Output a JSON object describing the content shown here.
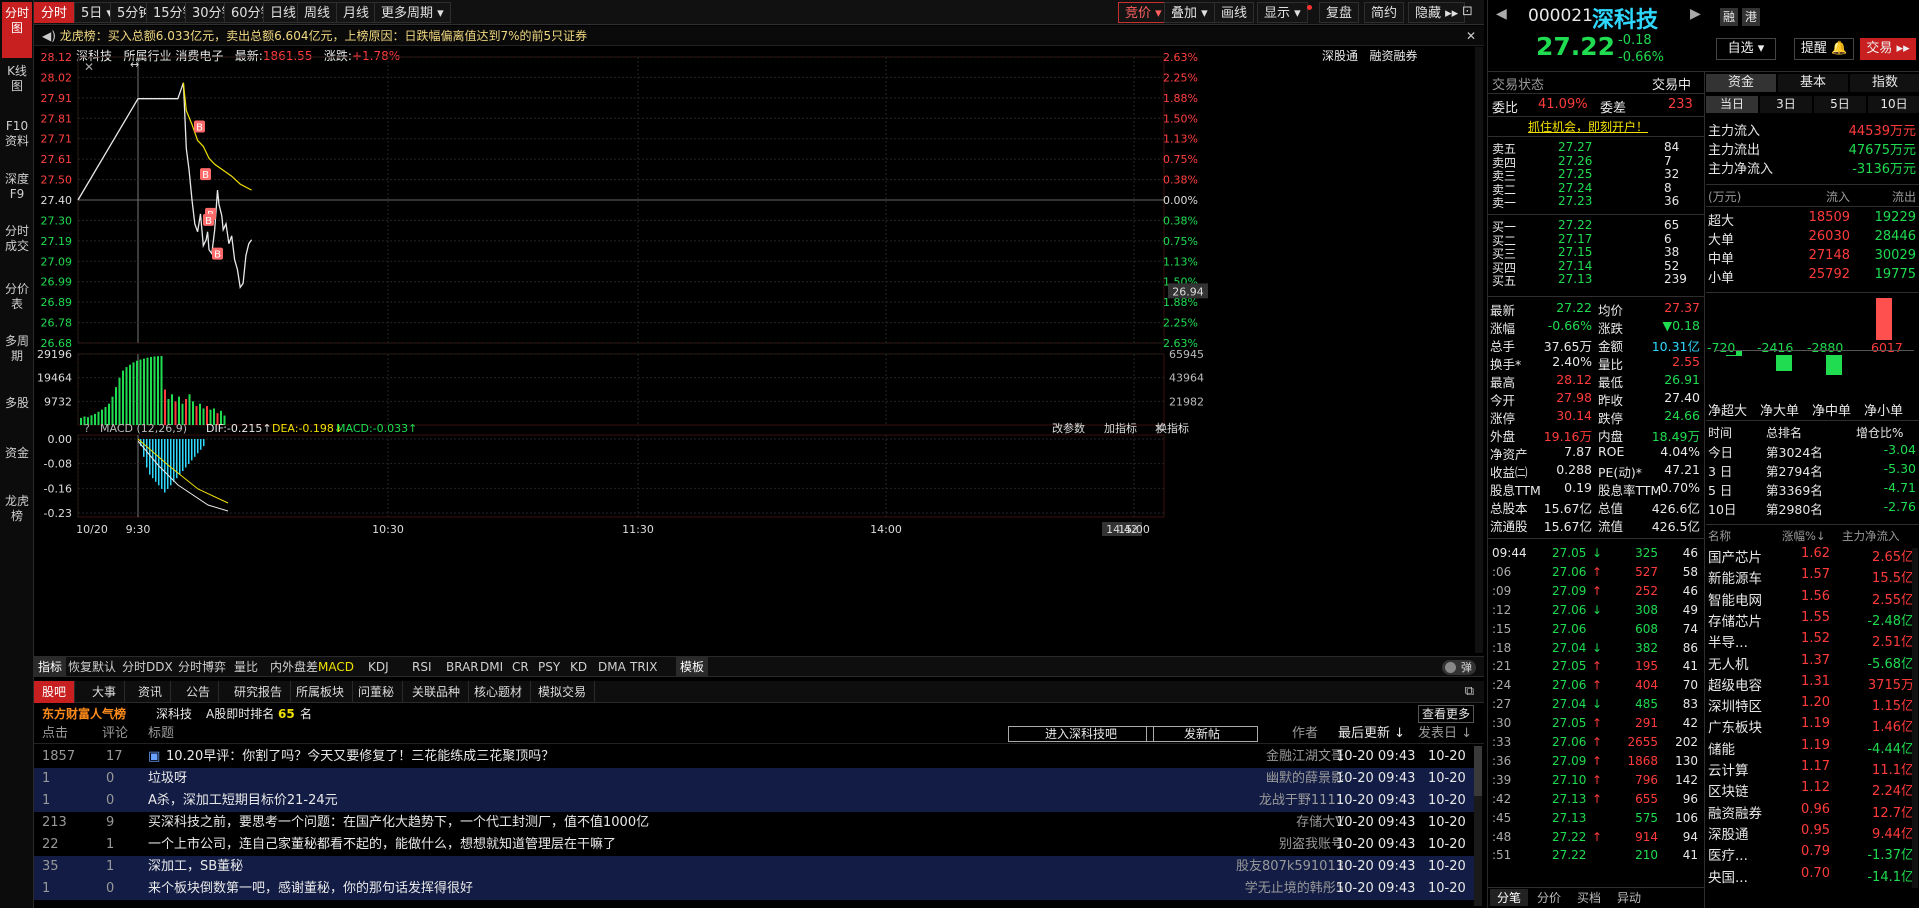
{
  "left_tabs": [
    "分时图",
    "K线图",
    "F10资料",
    "深度F9",
    "分时成交",
    "分价表",
    "多周期",
    "多股",
    "资金",
    "龙虎榜"
  ],
  "toolbar": {
    "periods": [
      "分时",
      "5日 ▾",
      "5分钟",
      "15分钟",
      "30分钟",
      "60分钟",
      "日线",
      "周线",
      "月线",
      "更多周期 ▾"
    ],
    "right": [
      "竞价 ▾",
      "叠加 ▾",
      "画线",
      "显示 ▾",
      "复盘",
      "简约",
      "隐藏 ▸▸"
    ]
  },
  "notice": "龙虎榜：买入总额6.033亿元，卖出总额6.604亿元，上榜原因：日跌幅偏离值达到7%的前5只证券",
  "chart_header": {
    "name": "深科技",
    "industry_label": "所属行业",
    "industry": "消费电子",
    "last_label": "最新:",
    "last": "1861.55",
    "change_label": "涨跌:",
    "change": "+1.78%",
    "links": [
      "深股通",
      "融资融券"
    ]
  },
  "chart_data": [
    {
      "type": "line",
      "title": "",
      "series": [
        {
          "name": "",
          "color": "#e8e8e8",
          "points": [
            [
              0,
              27.4
            ],
            [
              6,
              27.91
            ],
            [
              34,
              27.91
            ],
            [
              38,
              27.99
            ],
            [
              40,
              27.66
            ],
            [
              42,
              27.55
            ],
            [
              44,
              27.4
            ],
            [
              45,
              27.34
            ],
            [
              46,
              27.28
            ],
            [
              48,
              27.24
            ],
            [
              50,
              27.33
            ],
            [
              52,
              27.17
            ],
            [
              54,
              27.2
            ],
            [
              55,
              27.24
            ],
            [
              56,
              27.15
            ],
            [
              58,
              27.13
            ],
            [
              60,
              27.25
            ],
            [
              62,
              27.45
            ],
            [
              63,
              27.38
            ],
            [
              65,
              27.32
            ],
            [
              66,
              27.25
            ],
            [
              68,
              27.28
            ],
            [
              70,
              27.18
            ],
            [
              72,
              27.22
            ],
            [
              74,
              27.1
            ],
            [
              76,
              27.05
            ],
            [
              78,
              26.96
            ],
            [
              80,
              26.98
            ],
            [
              82,
              27.12
            ],
            [
              84,
              27.18
            ],
            [
              86,
              27.2
            ]
          ]
        },
        {
          "name": "",
          "color": "#f0e000",
          "points": [
            [
              38,
              27.99
            ],
            [
              40,
              27.85
            ],
            [
              44,
              27.78
            ],
            [
              48,
              27.7
            ],
            [
              52,
              27.67
            ],
            [
              56,
              27.61
            ],
            [
              60,
              27.58
            ],
            [
              66,
              27.55
            ],
            [
              72,
              27.52
            ],
            [
              78,
              27.48
            ],
            [
              86,
              27.45
            ]
          ]
        }
      ],
      "y_ticks": [
        "28.12",
        "28.02",
        "27.91",
        "27.81",
        "27.71",
        "27.61",
        "27.50",
        "27.40",
        "27.30",
        "27.19",
        "27.09",
        "26.99",
        "26.89",
        "26.78",
        "26.68"
      ],
      "y_pct": [
        "2.63%",
        "2.25%",
        "1.88%",
        "1.50%",
        "1.13%",
        "0.75%",
        "0.38%",
        "0.00%",
        "0.38%",
        "0.75%",
        "1.13%",
        "1.50%",
        "1.88%",
        "2.25%",
        "2.63%"
      ],
      "ylim": [
        26.68,
        28.12
      ],
      "prev_close": 27.4,
      "current": "26.94",
      "x_labels": [
        "10/20",
        "9:30",
        "10:30",
        "11:30",
        "14:00",
        "14:42",
        "15:00"
      ],
      "markers": [
        "B",
        "B",
        "B",
        "B",
        "B"
      ]
    },
    {
      "type": "bar",
      "title": "",
      "y_ticks": [
        "29196",
        "19464",
        "9732"
      ],
      "y_right": [
        "65945",
        "43964",
        "21982"
      ],
      "ylim": [
        0,
        29196
      ],
      "values": [
        3000,
        3600,
        3300,
        4100,
        4700,
        5600,
        6500,
        7600,
        9000,
        12000,
        16000,
        20000,
        23000,
        24500,
        25500,
        26500,
        27200,
        27700,
        28100,
        28500,
        28800,
        29000,
        29100,
        29196,
        15000,
        11000,
        13000,
        10000,
        12000,
        9000,
        11000,
        13000,
        10000,
        8000,
        9000,
        7000,
        8000,
        6500,
        7000,
        5000,
        6000,
        4000
      ]
    },
    {
      "type": "bar",
      "title": "MACD (12,26,9)",
      "labels": {
        "dif": "DIF:-0.215↑",
        "dea": "DEA:-0.198↓",
        "macd": "MACD:-0.033↑"
      },
      "y_ticks": [
        "0.00",
        "-0.08",
        "-0.16",
        "-0.23"
      ],
      "ylim": [
        -0.23,
        0.0
      ],
      "values": [
        -0.02,
        -0.05,
        -0.08,
        -0.1,
        -0.11,
        -0.12,
        -0.13,
        -0.14,
        -0.15,
        -0.14,
        -0.13,
        -0.12,
        -0.11,
        -0.1,
        -0.09,
        -0.08,
        -0.07,
        -0.06,
        -0.05,
        -0.04,
        -0.03,
        -0.02
      ],
      "links": [
        "改参数",
        "加指标",
        "换指标"
      ]
    }
  ],
  "indicator_tabs": [
    "指标",
    "恢复默认",
    "分时DDX",
    "分时博弈",
    "量比",
    "内外盘差",
    "MACD",
    "KDJ",
    "RSI",
    "BRAR",
    "DMI",
    "CR",
    "PSY",
    "KD",
    "DMA",
    "TRIX",
    "模板"
  ],
  "toggle_label": "弹",
  "forum": {
    "tabs": [
      "股吧",
      "大事",
      "资讯",
      "公告",
      "研究报告",
      "所属板块",
      "问董秘",
      "关联品种",
      "核心题材",
      "模拟交易"
    ],
    "banner": {
      "title": "东方财富人气榜",
      "stock": "深科技",
      "rank_label": "A股即时排名",
      "rank": "65",
      "unit": "名",
      "more": "查看更多"
    },
    "cols": {
      "clicks": "点击",
      "comments": "评论",
      "title": "标题",
      "btn1": "进入深科技吧",
      "btn2": "发新帖",
      "author": "作者",
      "last_update": "最后更新 ↓",
      "post_date": "发表日 ↓"
    },
    "rows": [
      {
        "clicks": "1857",
        "comments": "17",
        "title": "10.20早评：你割了吗？今天又要修复了！三花能练成三花聚顶吗？",
        "author": "金融江湖文哥",
        "updated": "10-20  09:43",
        "date": "10-20",
        "hl": false,
        "icon": true
      },
      {
        "clicks": "1",
        "comments": "0",
        "title": "垃圾呀",
        "author": "幽默的薛景影",
        "updated": "10-20  09:43",
        "date": "10-20",
        "hl": true,
        "icon": false
      },
      {
        "clicks": "1",
        "comments": "0",
        "title": "A杀，深加工短期目标价21-24元",
        "author": "龙战于野1111",
        "updated": "10-20  09:43",
        "date": "10-20",
        "hl": true,
        "icon": false
      },
      {
        "clicks": "213",
        "comments": "9",
        "title": "买深科技之前，要思考一个问题：在国产化大趋势下，一个代工封测厂，值不值1000亿",
        "author": "存储大V",
        "updated": "10-20  09:43",
        "date": "10-20",
        "hl": false,
        "icon": false
      },
      {
        "clicks": "22",
        "comments": "1",
        "title": "一个上市公司，连自己家董秘都看不起的，能做什么，想想就知道管理层在干嘛了",
        "author": "别盗我账号",
        "updated": "10-20  09:43",
        "date": "10-20",
        "hl": false,
        "icon": false
      },
      {
        "clicks": "35",
        "comments": "1",
        "title": "深加工，SB董秘",
        "author": "股友807k591013",
        "updated": "10-20  09:43",
        "date": "10-20",
        "hl": true,
        "icon": false
      },
      {
        "clicks": "1",
        "comments": "0",
        "title": "来个板块倒数第一吧，感谢董秘，你的那句话发挥得很好",
        "author": "学无止境的韩彤5",
        "updated": "10-20  09:43",
        "date": "10-20",
        "hl": true,
        "icon": false
      }
    ]
  },
  "quote": {
    "code": "000021",
    "name": "深科技",
    "price": "27.22",
    "chg": "-0.18",
    "pct": "-0.66%",
    "tags": [
      "融",
      "港"
    ],
    "btn_self": "自选 ▾",
    "btn_alert": "提醒 🔔",
    "btn_trade": "交易 ▸▸",
    "status_label": "交易状态",
    "status": "交易中",
    "wb_label": "委比",
    "wb": "41.09%",
    "wc_label": "委差",
    "wc": "233",
    "promo": "抓住机会，即刻开户！",
    "sell": [
      [
        "卖五",
        "27.27",
        "84"
      ],
      [
        "卖四",
        "27.26",
        "7"
      ],
      [
        "卖三",
        "27.25",
        "32"
      ],
      [
        "卖二",
        "27.24",
        "8"
      ],
      [
        "卖一",
        "27.23",
        "36"
      ]
    ],
    "buy": [
      [
        "买一",
        "27.22",
        "65"
      ],
      [
        "买二",
        "27.17",
        "6"
      ],
      [
        "买三",
        "27.15",
        "38"
      ],
      [
        "买四",
        "27.14",
        "52"
      ],
      [
        "买五",
        "27.13",
        "239"
      ]
    ],
    "stats": [
      [
        "最新",
        "27.22",
        "均价",
        "27.37"
      ],
      [
        "涨幅",
        "-0.66%",
        "涨跌",
        "▼0.18"
      ],
      [
        "总手",
        "37.65万",
        "金额",
        "10.31亿"
      ],
      [
        "换手*",
        "2.40%",
        "量比",
        "2.55"
      ],
      [
        "最高",
        "28.12",
        "最低",
        "26.91"
      ],
      [
        "今开",
        "27.98",
        "昨收",
        "27.40"
      ],
      [
        "涨停",
        "30.14",
        "跌停",
        "24.66"
      ],
      [
        "外盘",
        "19.16万",
        "内盘",
        "18.49万"
      ],
      [
        "净资产",
        "7.87",
        "ROE",
        "4.04%"
      ],
      [
        "收益㈡",
        "0.288",
        "PE(动)*",
        "47.21"
      ],
      [
        "股息TTM",
        "0.19",
        "股息率TTM",
        "0.70%"
      ],
      [
        "总股本",
        "15.67亿",
        "总值",
        "426.6亿"
      ],
      [
        "流通股",
        "15.67亿",
        "流值",
        "426.5亿"
      ]
    ]
  },
  "ticks": {
    "rows": [
      [
        "09:44",
        "27.05",
        "↓",
        "325",
        "46"
      ],
      [
        ":06",
        "27.06",
        "↑",
        "527",
        "58"
      ],
      [
        ":09",
        "27.09",
        "↑",
        "252",
        "46"
      ],
      [
        ":12",
        "27.06",
        "↓",
        "308",
        "49"
      ],
      [
        ":15",
        "27.06",
        "",
        "608",
        "74"
      ],
      [
        ":18",
        "27.04",
        "↓",
        "382",
        "86"
      ],
      [
        ":21",
        "27.05",
        "↑",
        "195",
        "41"
      ],
      [
        ":24",
        "27.06",
        "↑",
        "404",
        "70"
      ],
      [
        ":27",
        "27.04",
        "↓",
        "485",
        "83"
      ],
      [
        ":30",
        "27.05",
        "↑",
        "291",
        "42"
      ],
      [
        ":33",
        "27.06",
        "↑",
        "2655",
        "202"
      ],
      [
        ":36",
        "27.09",
        "↑",
        "1868",
        "130"
      ],
      [
        ":39",
        "27.10",
        "↑",
        "796",
        "142"
      ],
      [
        ":42",
        "27.13",
        "↑",
        "655",
        "96"
      ],
      [
        ":45",
        "27.13",
        "",
        "575",
        "106"
      ],
      [
        ":48",
        "27.22",
        "↑",
        "914",
        "94"
      ],
      [
        ":51",
        "27.22",
        "",
        "210",
        "41"
      ]
    ],
    "tabs": [
      "分笔",
      "分价",
      "买档",
      "异动"
    ]
  },
  "fund": {
    "tabs": [
      "资金",
      "基本",
      "指数"
    ],
    "sub": [
      "当日",
      "3日",
      "5日",
      "10日"
    ],
    "flows": [
      [
        "主力流入",
        "44539万元"
      ],
      [
        "主力流出",
        "47675万元"
      ],
      [
        "主力净流入",
        "-3136万元"
      ]
    ],
    "table_head": [
      "(万元)",
      "流入",
      "流出"
    ],
    "table": [
      [
        "超大",
        "18509",
        "19229"
      ],
      [
        "大单",
        "26030",
        "28446"
      ],
      [
        "中单",
        "27148",
        "30029"
      ],
      [
        "小单",
        "25792",
        "19775"
      ]
    ],
    "bars": [
      {
        "label": "-720",
        "value": -720
      },
      {
        "label": "-2416",
        "value": -2416
      },
      {
        "label": "-2880",
        "value": -2880
      },
      {
        "label": "6017",
        "value": 6017
      }
    ],
    "bar_names": [
      "净超大",
      "净大单",
      "净中单",
      "净小单"
    ],
    "rank_head": [
      "时间",
      "总排名",
      "增仓比%"
    ],
    "ranks": [
      [
        "今日",
        "第3024名",
        "-3.04"
      ],
      [
        "3 日",
        "第2794名",
        "-5.30"
      ],
      [
        "5 日",
        "第3369名",
        "-4.71"
      ],
      [
        "10日",
        "第2980名",
        "-2.76"
      ]
    ],
    "sector_head": [
      "名称",
      "涨幅%↓",
      "主力净流入"
    ],
    "sectors": [
      [
        "国产芯片",
        "1.62",
        "2.65亿"
      ],
      [
        "新能源车",
        "1.57",
        "15.5亿"
      ],
      [
        "智能电网",
        "1.56",
        "2.55亿"
      ],
      [
        "存储芯片",
        "1.55",
        "-2.48亿"
      ],
      [
        "半导...",
        "1.52",
        "2.51亿"
      ],
      [
        "无人机",
        "1.37",
        "-5.68亿"
      ],
      [
        "超级电容",
        "1.31",
        "3715万"
      ],
      [
        "深圳特区",
        "1.20",
        "1.15亿"
      ],
      [
        "广东板块",
        "1.19",
        "1.46亿"
      ],
      [
        "储能",
        "1.19",
        "-4.44亿"
      ],
      [
        "云计算",
        "1.17",
        "11.1亿"
      ],
      [
        "区块链",
        "1.12",
        "2.24亿"
      ],
      [
        "融资融券",
        "0.96",
        "12.7亿"
      ],
      [
        "深股通",
        "0.95",
        "9.44亿"
      ],
      [
        "医疗...",
        "0.79",
        "-1.37亿"
      ],
      [
        "央国...",
        "0.70",
        "-14.1亿"
      ]
    ]
  },
  "colors": {
    "up": "#ff3b3b",
    "down": "#1fdc50",
    "accent": "#c82020",
    "yellow": "#f0e000",
    "cyan": "#2fd8ff"
  }
}
